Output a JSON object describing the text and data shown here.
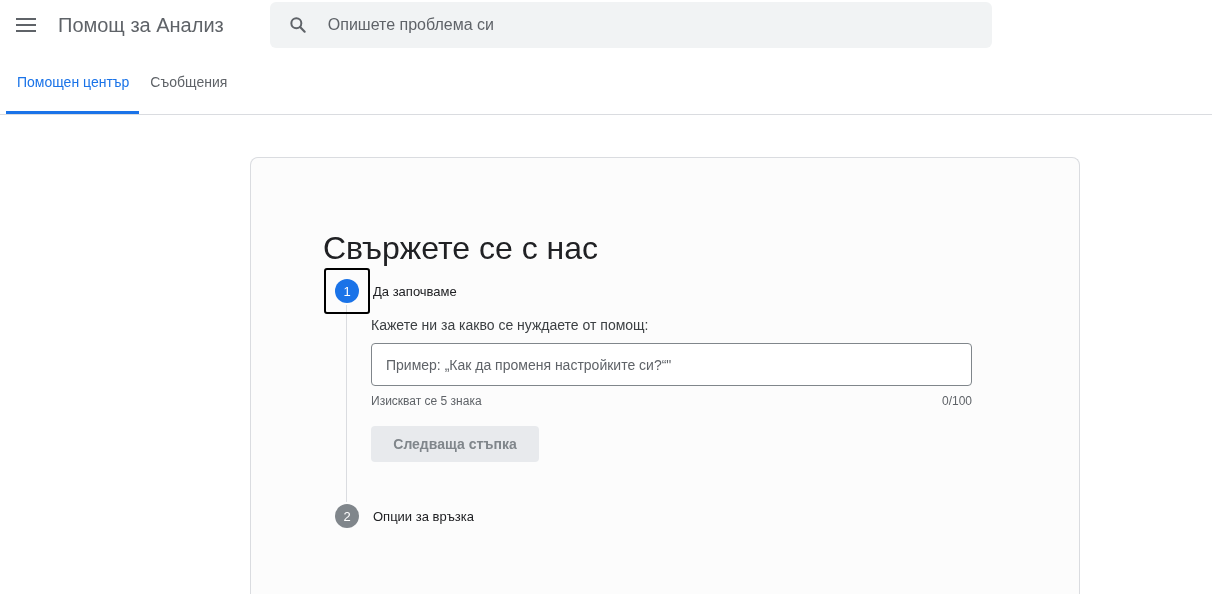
{
  "header": {
    "title": "Помощ за Анализ",
    "search": {
      "placeholder": "Опишете проблема си"
    }
  },
  "tabs": [
    {
      "label": "Помощен център",
      "selected": true
    },
    {
      "label": "Съобщения",
      "selected": false
    }
  ],
  "contact": {
    "heading": "Свържете се с нас",
    "steps": [
      {
        "number": "1",
        "label": "Да започваме",
        "selected": true,
        "focused": true
      },
      {
        "number": "2",
        "label": "Опции за връзка",
        "selected": false,
        "focused": false
      }
    ],
    "question": {
      "label": "Кажете ни за какво се нуждаете от помощ:",
      "placeholder": "Пример: „Как да променя настройките си?“\"",
      "hint": "Изискват се 5 знака",
      "counter": "0/100"
    },
    "next_button": {
      "label": "Следваща стъпка",
      "disabled": true
    }
  }
}
